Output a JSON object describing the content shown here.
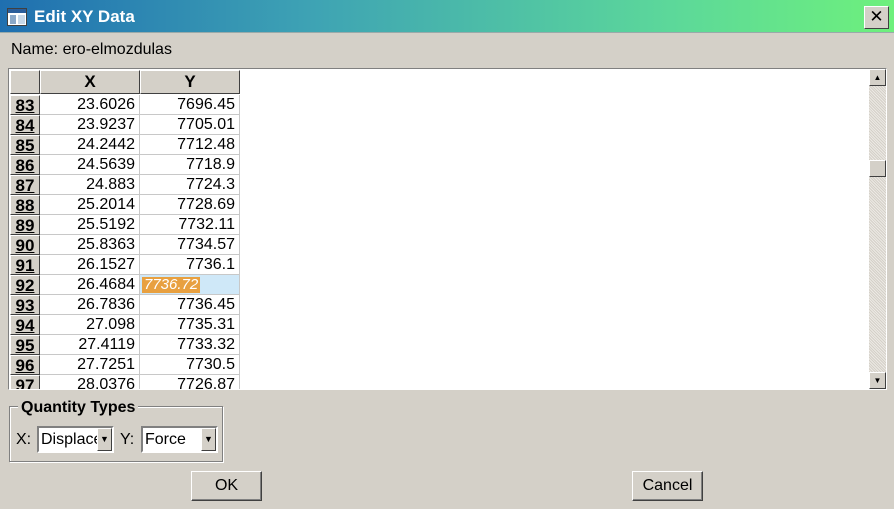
{
  "window": {
    "title": "Edit XY Data",
    "close_glyph": "✕"
  },
  "name_label": "Name: ero-elmozdulas",
  "table": {
    "columns": [
      "X",
      "Y"
    ],
    "rows": [
      {
        "index": "83",
        "x": "23.6026",
        "y": "7696.45"
      },
      {
        "index": "84",
        "x": "23.9237",
        "y": "7705.01"
      },
      {
        "index": "85",
        "x": "24.2442",
        "y": "7712.48"
      },
      {
        "index": "86",
        "x": "24.5639",
        "y": "7718.9"
      },
      {
        "index": "87",
        "x": "24.883",
        "y": "7724.3"
      },
      {
        "index": "88",
        "x": "25.2014",
        "y": "7728.69"
      },
      {
        "index": "89",
        "x": "25.5192",
        "y": "7732.11"
      },
      {
        "index": "90",
        "x": "25.8363",
        "y": "7734.57"
      },
      {
        "index": "91",
        "x": "26.1527",
        "y": "7736.1"
      },
      {
        "index": "92",
        "x": "26.4684",
        "y": "7736.72"
      },
      {
        "index": "93",
        "x": "26.7836",
        "y": "7736.45"
      },
      {
        "index": "94",
        "x": "27.098",
        "y": "7735.31"
      },
      {
        "index": "95",
        "x": "27.4119",
        "y": "7733.32"
      },
      {
        "index": "96",
        "x": "27.7251",
        "y": "7730.5"
      },
      {
        "index": "97",
        "x": "28.0376",
        "y": "7726.87"
      }
    ],
    "editing_row": 9
  },
  "scrollbar": {
    "up_glyph": "▲",
    "down_glyph": "▼"
  },
  "quantity_types": {
    "title": "Quantity Types",
    "x_label": "X:",
    "x_value": "Displacement",
    "y_label": "Y:",
    "y_value": "Force",
    "arrow_glyph": "▼"
  },
  "buttons": {
    "ok": "OK",
    "cancel": "Cancel"
  },
  "colors": {
    "edit_highlight": "#e8a040",
    "edit_cell_bg": "#cfe8f8"
  }
}
